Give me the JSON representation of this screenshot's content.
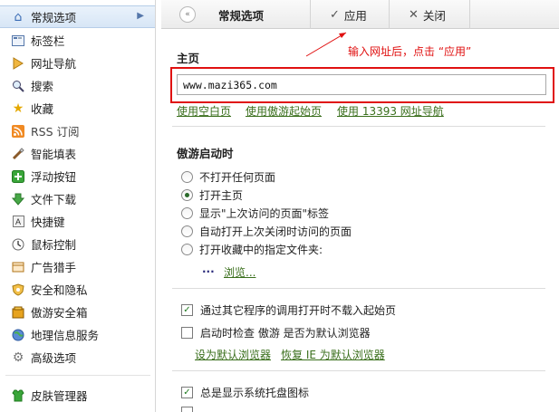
{
  "sidebar": {
    "items": [
      {
        "label": "常规选项",
        "icon": "home-icon",
        "selected": true
      },
      {
        "label": "标签栏",
        "icon": "tabbar-icon"
      },
      {
        "label": "网址导航",
        "icon": "nav-icon"
      },
      {
        "label": "搜索",
        "icon": "search-icon"
      },
      {
        "label": "收藏",
        "icon": "star-icon"
      },
      {
        "label": "RSS 订阅",
        "icon": "rss-icon"
      },
      {
        "label": "智能填表",
        "icon": "form-fill-icon"
      },
      {
        "label": "浮动按钮",
        "icon": "float-button-icon"
      },
      {
        "label": "文件下载",
        "icon": "download-icon"
      },
      {
        "label": "快捷键",
        "icon": "shortcut-icon"
      },
      {
        "label": "鼠标控制",
        "icon": "mouse-icon"
      },
      {
        "label": "广告猎手",
        "icon": "ad-hunter-icon"
      },
      {
        "label": "安全和隐私",
        "icon": "shield-icon"
      },
      {
        "label": "傲游安全箱",
        "icon": "safe-box-icon"
      },
      {
        "label": "地理信息服务",
        "icon": "geo-icon"
      },
      {
        "label": "高级选项",
        "icon": "gear-icon"
      },
      {
        "label": "皮肤管理器",
        "icon": "skin-icon"
      }
    ]
  },
  "toolbar": {
    "title": "常规选项",
    "apply_label": "应用",
    "close_label": "关闭"
  },
  "annotation": {
    "text": "输入网址后，点击 “应用”"
  },
  "homepage": {
    "section_title": "主页",
    "url_value": "www.mazi365.com",
    "links": [
      "使用空白页",
      "使用傲游起始页",
      "使用 13393 网址导航"
    ]
  },
  "startup": {
    "section_title": "傲游启动时",
    "options": [
      {
        "label": "不打开任何页面",
        "selected": false
      },
      {
        "label": "打开主页",
        "selected": true
      },
      {
        "label": "显示\"上次访问的页面\"标签",
        "selected": false
      },
      {
        "label": "自动打开上次关闭时访问的页面",
        "selected": false
      },
      {
        "label": "打开收藏中的指定文件夹:",
        "selected": false
      }
    ],
    "folder_dots": "...",
    "browse_link": "浏览..."
  },
  "checks": {
    "startpage": {
      "label": "通过其它程序的调用打开时不载入起始页",
      "checked": true
    },
    "default_check": {
      "label": "启动时检查 傲游 是否为默认浏览器",
      "checked": false
    },
    "set_default_link": "设为默认浏览器",
    "restore_ie_link": "恢复 IE 为默认浏览器",
    "tray": {
      "label": "总是显示系统托盘图标",
      "checked": true
    }
  },
  "colors": {
    "highlight": "#e01010",
    "link": "#3a6f1c",
    "selected_bg": "#d7e6f6"
  }
}
